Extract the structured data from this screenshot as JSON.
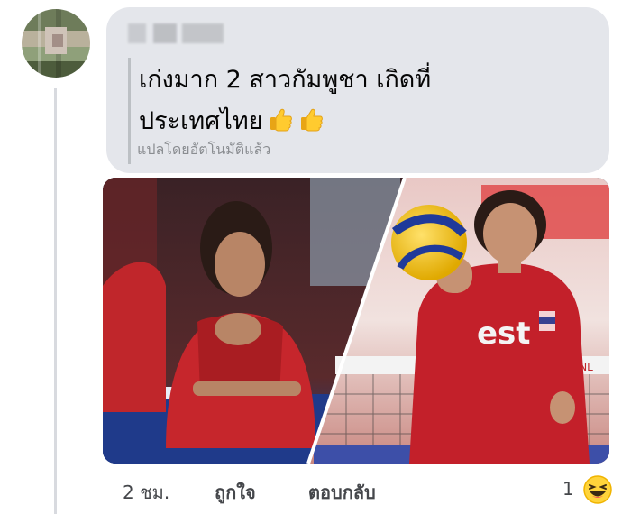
{
  "comment": {
    "author_name_blurred": "",
    "text": "เก่งมาก 2 สาวกัมพูชา เกิดที่\nประเทศไทย",
    "translated_label": "แปลโดยอัตโนมัติแล้ว",
    "emoji": [
      "thumbs-up-icon",
      "thumbs-up-icon"
    ]
  },
  "footer": {
    "time": "2 ชม.",
    "like_label": "ถูกใจ",
    "reply_label": "ตอบกลับ",
    "reaction_count": "1",
    "reaction_icon": "laughing-emoji-icon"
  },
  "photo": {
    "jersey_text": "est",
    "net_text": "VNL"
  },
  "colors": {
    "bubble": "#e4e6eb",
    "text": "#050505",
    "muted": "#8a8d91",
    "jersey_red": "#b3141c"
  }
}
